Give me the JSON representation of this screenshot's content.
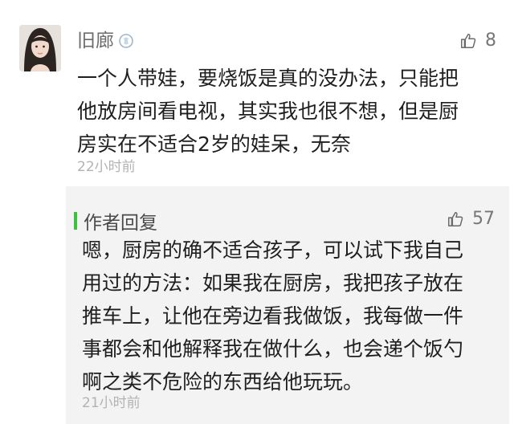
{
  "comment": {
    "username": "旧廊",
    "badge_icon": "vip-badge-icon",
    "likes": "8",
    "like_icon": "thumbs-up-icon",
    "text_lines": [
      "一个人带娃，要烧饭是真的没办法，只能把",
      "他放房间看电视，其实我也很不想，但是厨",
      "房实在不适合2岁的娃呆，无奈"
    ],
    "time": "22小时前"
  },
  "reply": {
    "label": "作者回复",
    "likes": "57",
    "like_icon": "thumbs-up-icon",
    "accent_color": "#3fbf3f",
    "text_lines": [
      "嗯，厨房的确不适合孩子，可以试下我自己",
      "用过的方法：如果我在厨房，我把孩子放在",
      "推车上，让他在旁边看我做饭，我每做一件",
      "事都会和他解释我在做什么，也会递个饭勺",
      "啊之类不危险的东西给他玩玩。"
    ],
    "time": "21小时前"
  }
}
